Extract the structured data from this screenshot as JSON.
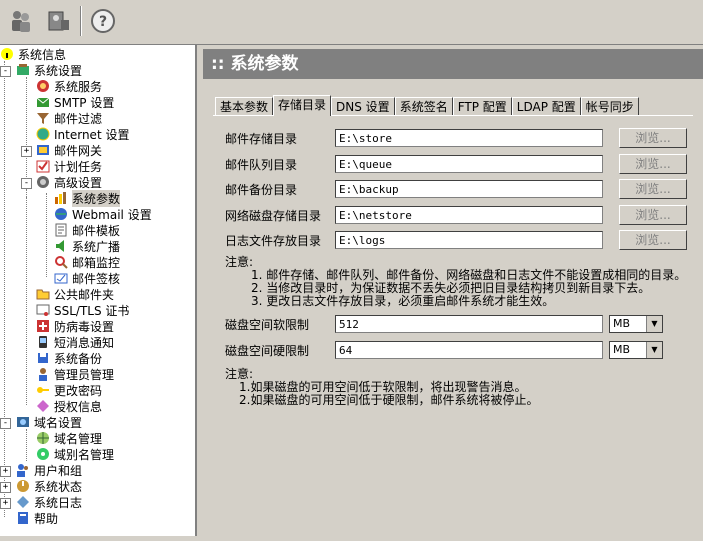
{
  "toolbar": {
    "icons": [
      "users-icon",
      "user-add-icon",
      "help-icon"
    ]
  },
  "tree": {
    "items": [
      {
        "label": "系统信息",
        "icon": "info-icon"
      },
      {
        "label": "系统设置",
        "icon": "settings-icon"
      },
      {
        "label": "系统服务",
        "icon": "service-icon"
      },
      {
        "label": "SMTP 设置",
        "icon": "smtp-icon"
      },
      {
        "label": "邮件过滤",
        "icon": "filter-icon"
      },
      {
        "label": "Internet 设置",
        "icon": "internet-icon"
      },
      {
        "label": "邮件网关",
        "icon": "gateway-icon"
      },
      {
        "label": "计划任务",
        "icon": "schedule-icon"
      },
      {
        "label": "高级设置",
        "icon": "advanced-icon"
      },
      {
        "label": "系统参数",
        "icon": "params-icon"
      },
      {
        "label": "Webmail 设置",
        "icon": "webmail-icon"
      },
      {
        "label": "邮件模板",
        "icon": "template-icon"
      },
      {
        "label": "系统广播",
        "icon": "broadcast-icon"
      },
      {
        "label": "邮箱监控",
        "icon": "monitor-icon"
      },
      {
        "label": "邮件签核",
        "icon": "approve-icon"
      },
      {
        "label": "公共邮件夹",
        "icon": "folder-icon"
      },
      {
        "label": "SSL/TLS 证书",
        "icon": "certificate-icon"
      },
      {
        "label": "防病毒设置",
        "icon": "antivirus-icon"
      },
      {
        "label": "短消息通知",
        "icon": "sms-icon"
      },
      {
        "label": "系统备份",
        "icon": "backup-icon"
      },
      {
        "label": "管理员管理",
        "icon": "admin-icon"
      },
      {
        "label": "更改密码",
        "icon": "password-icon"
      },
      {
        "label": "授权信息",
        "icon": "license-icon"
      },
      {
        "label": "域名设置",
        "icon": "domain-icon"
      },
      {
        "label": "域名管理",
        "icon": "domain-manage-icon"
      },
      {
        "label": "域别名管理",
        "icon": "alias-icon"
      },
      {
        "label": "用户和组",
        "icon": "users-groups-icon"
      },
      {
        "label": "系统状态",
        "icon": "status-icon"
      },
      {
        "label": "系统日志",
        "icon": "log-icon"
      },
      {
        "label": "帮助",
        "icon": "help-book-icon"
      }
    ]
  },
  "main": {
    "title": ":: 系统参数",
    "tabs": [
      "基本参数",
      "存储目录",
      "DNS 设置",
      "系统签名",
      "FTP 配置",
      "LDAP 配置",
      "帐号同步"
    ],
    "active_tab": "存储目录",
    "dirs": [
      {
        "label": "邮件存储目录",
        "value": "E:\\store"
      },
      {
        "label": "邮件队列目录",
        "value": "E:\\queue"
      },
      {
        "label": "邮件备份目录",
        "value": "E:\\backup"
      },
      {
        "label": "网络磁盘存储目录",
        "value": "E:\\netstore"
      },
      {
        "label": "日志文件存放目录",
        "value": "E:\\logs"
      }
    ],
    "browse_label": "浏览...",
    "note1_title": "注意:",
    "note1": [
      "1. 邮件存储、邮件队列、邮件备份、网络磁盘和日志文件不能设置成相同的目录。",
      "2. 当修改目录时，为保证数据不丢失必须把旧目录结构拷贝到新目录下去。",
      "3. 更改日志文件存放目录，必须重启邮件系统才能生效。"
    ],
    "disk": [
      {
        "label": "磁盘空间软限制",
        "value": "512",
        "unit": "MB"
      },
      {
        "label": "磁盘空间硬限制",
        "value": "64",
        "unit": "MB"
      }
    ],
    "note2_title": "注意:",
    "note2": [
      "1.如果磁盘的可用空间低于软限制，将出现警告消息。",
      "2.如果磁盘的可用空间低于硬限制，邮件系统将被停止。"
    ]
  }
}
